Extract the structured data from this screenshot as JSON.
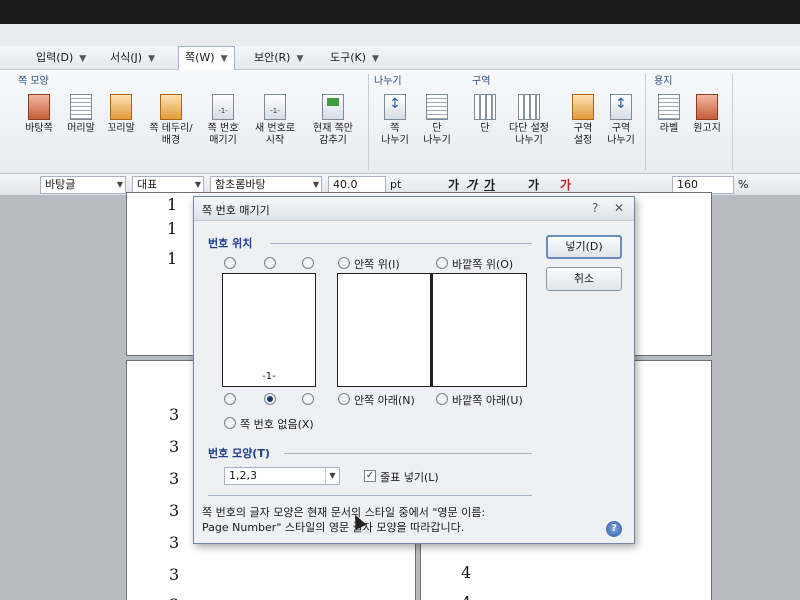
{
  "menubar": {
    "items": [
      {
        "label": "입력(D)"
      },
      {
        "label": "서식(J)"
      },
      {
        "label": "쪽(W)"
      },
      {
        "label": "보안(R)"
      },
      {
        "label": "도구(K)"
      }
    ]
  },
  "ribbon": {
    "groups": {
      "page_shape": "쪽 모양",
      "divide": "나누기",
      "section": "구역",
      "paper": "용지"
    },
    "buttons": {
      "background": "바탕쪽",
      "header": "머리말",
      "footer": "꼬리말",
      "border_line1": "쪽 테두리/",
      "border_line2": "배경",
      "pagenum_line1": "쪽 번호",
      "pagenum_line2": "매기기",
      "newnum_line1": "새 번호로",
      "newnum_line2": "시작",
      "hide_line1": "현재 쪽만",
      "hide_line2": "감추기",
      "pagebreak_line1": "쪽",
      "pagebreak_line2": "나누기",
      "colbreak_line1": "단",
      "colbreak_line2": "나누기",
      "col": "단",
      "multicol_line1": "다단 설정",
      "multicol_line2": "나누기",
      "secset_line1": "구역",
      "secset_line2": "설정",
      "secbreak_line1": "구역",
      "secbreak_line2": "나누기",
      "label": "라벨",
      "manuscript": "원고지"
    }
  },
  "formatbar": {
    "style": "바탕글",
    "lang": "대표",
    "font": "함초롬바탕",
    "size": "40.0",
    "unit": "pt",
    "bold": "가",
    "italic": "가",
    "underline": "가",
    "strike": "가",
    "color": "가",
    "zoom": "160",
    "zoom_unit": "%"
  },
  "document": {
    "top_left_page": [
      "1",
      "1",
      "1"
    ],
    "bottom_left_page": [
      "3",
      "3",
      "3",
      "3",
      "3",
      "3",
      "3"
    ],
    "bottom_right_page": [
      "4",
      "4"
    ]
  },
  "dialog": {
    "title": "쪽 번호 매기기",
    "position_section": "번호 위치",
    "preview_page_number": "-1-",
    "radio_inner_top": "안쪽 위(I)",
    "radio_outer_top": "바깥쪽 위(O)",
    "radio_inner_bottom": "안쪽 아래(N)",
    "radio_outer_bottom": "바깥쪽 아래(U)",
    "radio_none": "쪽 번호 없음(X)",
    "shape_section": "번호 모양(T)",
    "shape_value": "1,2,3",
    "dash_checkbox": "줄표 넣기(L)",
    "insert_button": "넣기(D)",
    "cancel_button": "취소",
    "desc_line1": "쪽 번호의 글자 모양은 현재 문서의 스타일 중에서 \"영문 이름:",
    "desc_line2": "Page Number\" 스타일의 영문 글자 모양을 따라갑니다.",
    "help": "?"
  }
}
